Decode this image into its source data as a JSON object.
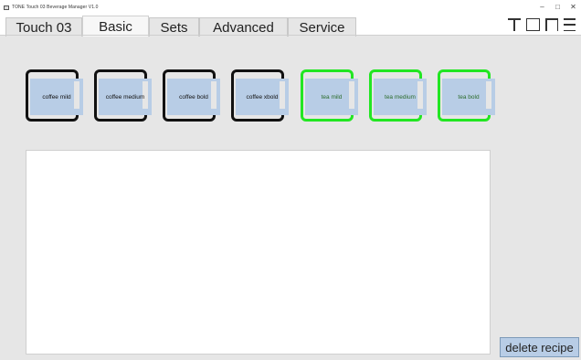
{
  "window": {
    "title": "TONE Touch 03   Beverage Manager   V1.0",
    "controls": [
      "–",
      "□",
      "✕"
    ]
  },
  "tabs": [
    {
      "label": "Touch 03",
      "active": false
    },
    {
      "label": "Basic",
      "active": true
    },
    {
      "label": "Sets",
      "active": false
    },
    {
      "label": "Advanced",
      "active": false
    },
    {
      "label": "Service",
      "active": false
    }
  ],
  "logo": {
    "text": "TONE"
  },
  "recipes": [
    {
      "label": "coffee mild",
      "kind": "coffee"
    },
    {
      "label": "coffee medium",
      "kind": "coffee"
    },
    {
      "label": "coffee bold",
      "kind": "coffee"
    },
    {
      "label": "coffee xbold",
      "kind": "coffee"
    },
    {
      "label": "tea mild",
      "kind": "tea"
    },
    {
      "label": "tea medium",
      "kind": "tea"
    },
    {
      "label": "tea bold",
      "kind": "tea"
    }
  ],
  "actions": {
    "delete_label": "delete recipe"
  },
  "colors": {
    "coffee_border": "#111111",
    "tea_border": "#22e622",
    "button_fill": "#b8cde6",
    "background": "#e6e6e6"
  }
}
